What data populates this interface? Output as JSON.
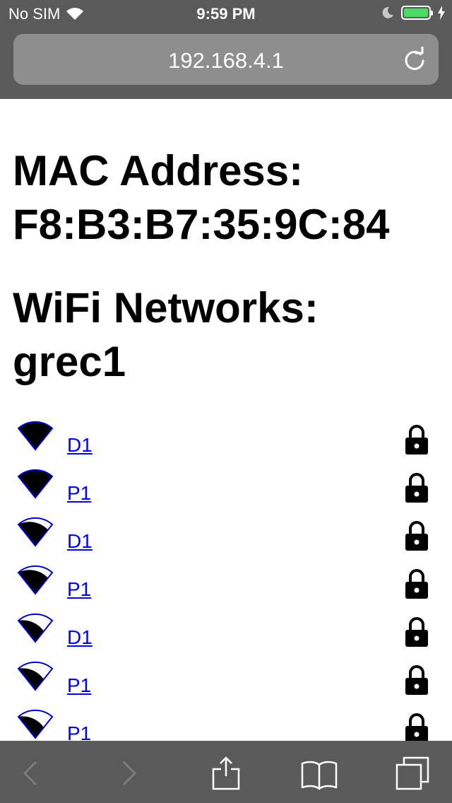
{
  "status_bar": {
    "carrier": "No SIM",
    "time": "9:59 PM",
    "battery_level": 1.0,
    "battery_color": "#4cd964",
    "icons": [
      "wifi-icon",
      "moon-icon",
      "battery-icon",
      "charging-bolt-icon"
    ]
  },
  "browser": {
    "url": "192.168.4.1",
    "reload_icon": "reload-icon"
  },
  "page": {
    "mac_heading": "MAC Address:",
    "mac_value": "F8:B3:B7:35:9C:84",
    "wifi_heading": "WiFi Networks:",
    "wifi_value": "grec1",
    "link_color": "#0000ee"
  },
  "networks": [
    {
      "ssid": "D1",
      "signal_bars": 4,
      "locked": true
    },
    {
      "ssid": "P1",
      "signal_bars": 4,
      "locked": true
    },
    {
      "ssid": "D1",
      "signal_bars": 3,
      "locked": true
    },
    {
      "ssid": "P1",
      "signal_bars": 3,
      "locked": true
    },
    {
      "ssid": "D1",
      "signal_bars": 2,
      "locked": true
    },
    {
      "ssid": "P1",
      "signal_bars": 2,
      "locked": true
    },
    {
      "ssid": "P1",
      "signal_bars": 2,
      "locked": true
    }
  ],
  "toolbar": {
    "icons": [
      "back-icon",
      "forward-icon",
      "share-icon",
      "bookmarks-icon",
      "tabs-icon"
    ]
  }
}
